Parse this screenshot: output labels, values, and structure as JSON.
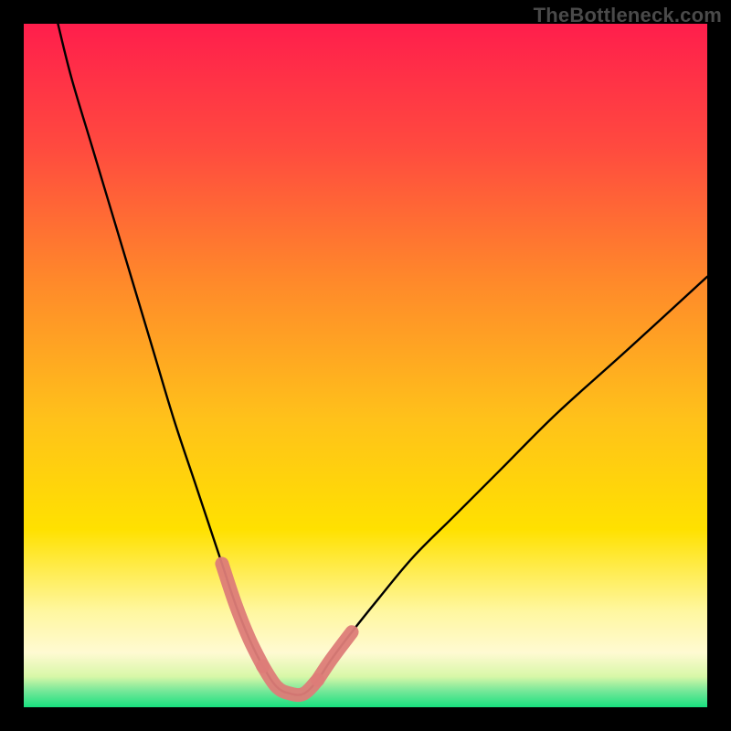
{
  "watermark": "TheBottleneck.com",
  "colors": {
    "frame_bg": "#000000",
    "gradient_top": "#ff1e4c",
    "gradient_mid": "#ffd400",
    "gradient_low": "#fff9b8",
    "gradient_green": "#18e07f",
    "curve_stroke": "#000000",
    "accent_stroke": "#dd7c78"
  },
  "chart_data": {
    "type": "line",
    "title": "",
    "xlabel": "",
    "ylabel": "",
    "xlim": [
      0,
      100
    ],
    "ylim": [
      0,
      100
    ],
    "grid": false,
    "legend": false,
    "description": "V-shaped bottleneck curve: steep descent from top-left to a flat valley around x≈35–42, then a shallower ascent toward the right edge.",
    "series": [
      {
        "name": "bottleneck-curve",
        "x": [
          5,
          7,
          10,
          13,
          16,
          19,
          22,
          25,
          27,
          29,
          31,
          33,
          35,
          37,
          39,
          41,
          43,
          45,
          48,
          52,
          57,
          63,
          70,
          78,
          88,
          100
        ],
        "y": [
          100,
          92,
          82,
          72,
          62,
          52,
          42,
          33,
          27,
          21,
          15,
          10,
          6,
          3,
          2,
          2,
          4,
          7,
          11,
          16,
          22,
          28,
          35,
          43,
          52,
          63
        ]
      }
    ],
    "highlight_segments": [
      {
        "name": "left-accent",
        "x": [
          29,
          31,
          33,
          35
        ],
        "y": [
          21,
          15,
          10,
          6
        ]
      },
      {
        "name": "valley-accent",
        "x": [
          35,
          37,
          39,
          41,
          43
        ],
        "y": [
          6,
          3,
          2,
          2,
          4
        ]
      },
      {
        "name": "right-accent",
        "x": [
          43,
          45,
          48
        ],
        "y": [
          4,
          7,
          11
        ]
      }
    ]
  }
}
